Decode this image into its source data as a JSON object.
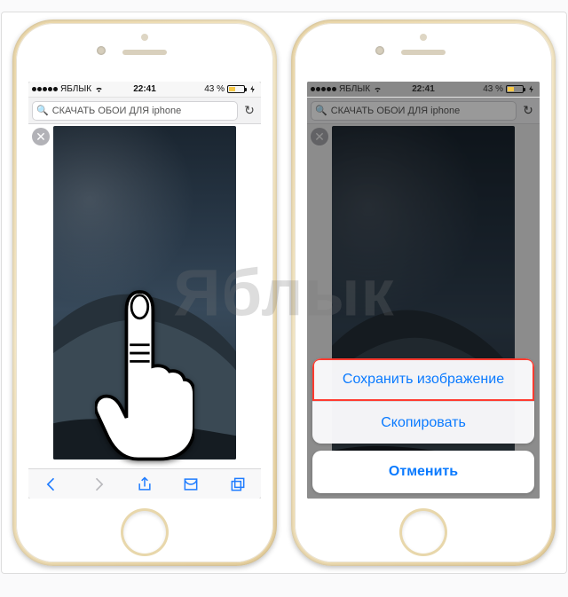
{
  "statusbar": {
    "carrier": "ЯБЛЫК",
    "time": "22:41",
    "battery": "43 %"
  },
  "address": {
    "query": "СКАЧАТЬ ОБОИ ДЛЯ iphone"
  },
  "actionsheet": {
    "save": "Сохранить изображение",
    "copy": "Скопировать",
    "cancel": "Отменить"
  },
  "watermark": "Яблык"
}
